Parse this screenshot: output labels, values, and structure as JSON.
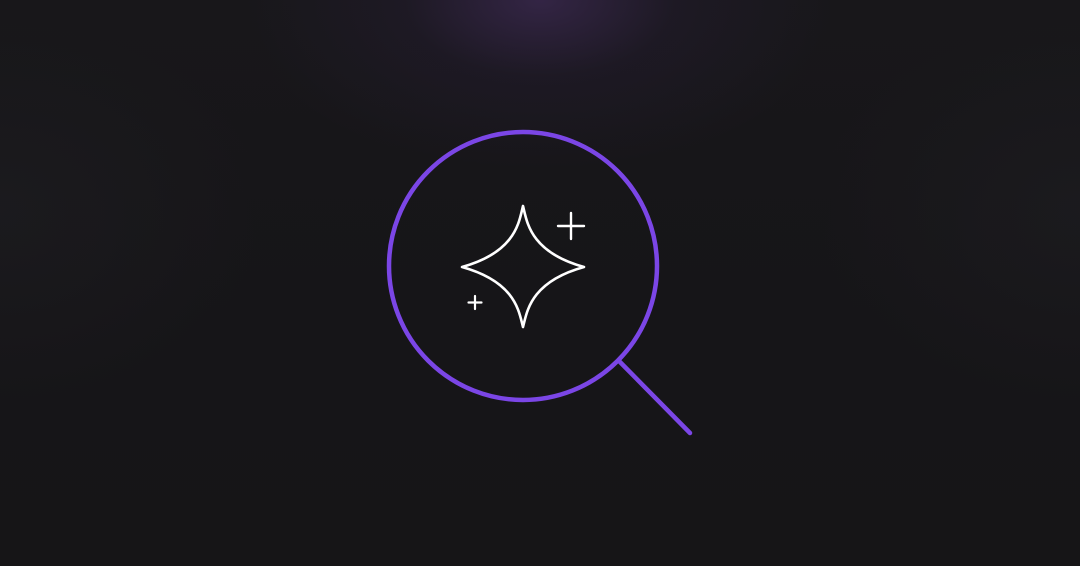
{
  "illustration": {
    "icon": "magnifier-sparkle-icon",
    "colors": {
      "background": "#161517",
      "glow": "#4a3068",
      "magnifier_ring": "#7b46e6",
      "sparkle": "#ffffff"
    }
  }
}
